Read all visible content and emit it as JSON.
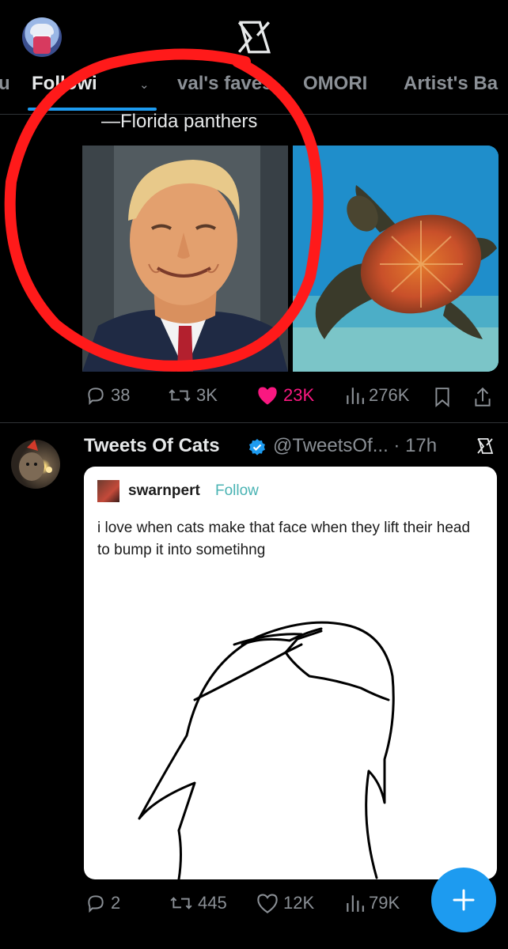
{
  "header": {
    "tabs": [
      {
        "label": "u"
      },
      {
        "label": "Followi"
      },
      {
        "label": "val's faves"
      },
      {
        "label": "OMORI"
      },
      {
        "label": "Artist's Ba"
      }
    ]
  },
  "post1": {
    "text": "—Florida panthers",
    "actions": {
      "replies": "38",
      "reposts": "3K",
      "likes": "23K",
      "views": "276K"
    }
  },
  "post2": {
    "author_name": "Tweets Of Cats",
    "handle_time": "@TweetsOf... · 17h",
    "quote": {
      "user": "swarnpert",
      "follow_label": "Follow",
      "text": "i love when cats make that face when they lift their head to bump it into sometihng"
    },
    "actions": {
      "replies": "2",
      "reposts": "445",
      "likes": "12K",
      "views": "79K"
    }
  },
  "colors": {
    "accent": "#1d9bf0",
    "like_active": "#f91880",
    "muted": "#8b9096",
    "annotation": "#ff1a1a"
  },
  "icons": [
    "x-logo-icon",
    "reply-icon",
    "repost-icon",
    "heart-icon",
    "views-icon",
    "bookmark-icon",
    "share-icon",
    "verified-icon",
    "compose-plus-icon"
  ]
}
